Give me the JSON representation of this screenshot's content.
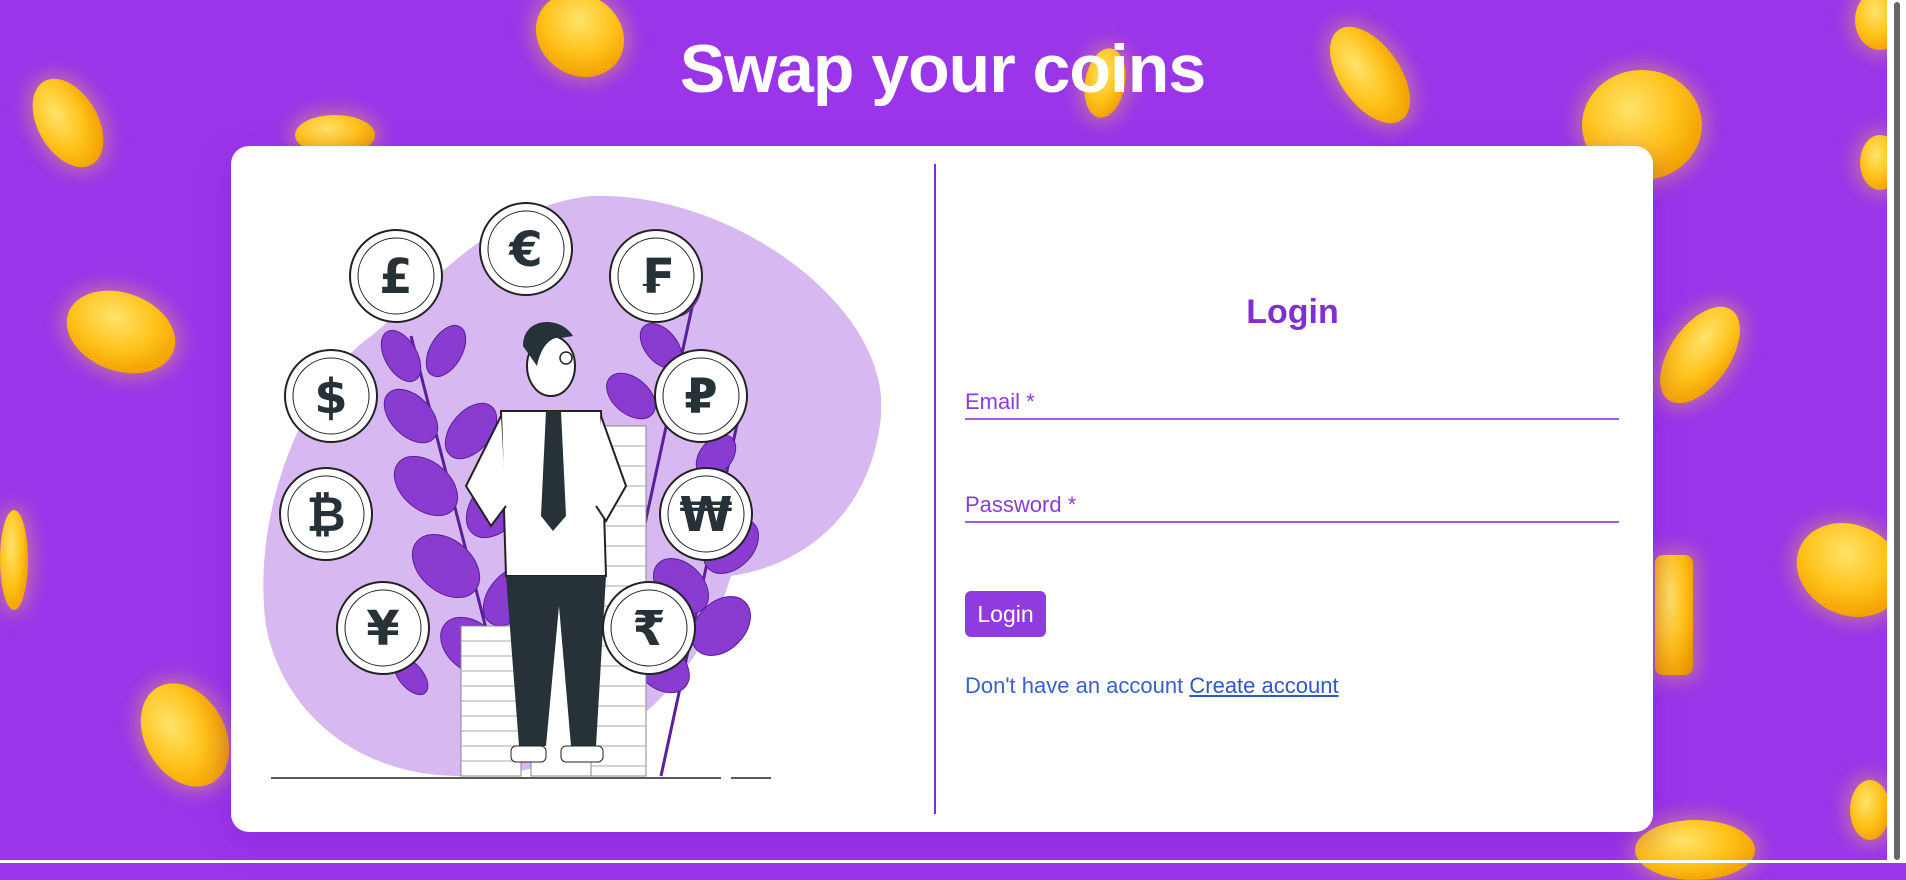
{
  "page": {
    "title": "Swap your coins"
  },
  "login": {
    "heading": "Login",
    "email_label": "Email *",
    "password_label": "Password *",
    "submit_label": "Login",
    "signup_prompt": "Don't have an account",
    "signup_link": "Create account"
  },
  "illustration": {
    "coin_symbols": [
      "£",
      "€",
      "₣",
      "$",
      "₽",
      "₿",
      "₩",
      "¥",
      "₹"
    ]
  },
  "colors": {
    "background": "#9a35ea",
    "accent": "#8f3be0",
    "link": "#3157c6",
    "coin": "#ffc21a"
  }
}
